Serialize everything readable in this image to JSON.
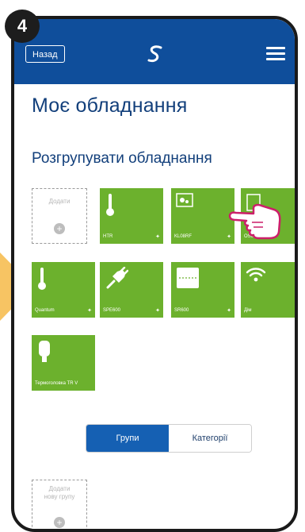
{
  "step": {
    "number": "4"
  },
  "header": {
    "back_label": "Назад"
  },
  "page_title": "Моє обладнання",
  "section_title": "Розгрупувати обладнання",
  "add_device": {
    "label": "Додати"
  },
  "devices": [
    {
      "label": "HTR",
      "icon": "thermometer-icon"
    },
    {
      "label": "KL08RF",
      "icon": "controller-box-icon"
    },
    {
      "label": "OS600",
      "icon": "window-sensor-icon"
    },
    {
      "label": "Quantum",
      "icon": "thermometer-icon"
    },
    {
      "label": "SPE600",
      "icon": "plug-icon"
    },
    {
      "label": "SR600",
      "icon": "relay-box-icon"
    },
    {
      "label": "Дім",
      "icon": "wifi-icon"
    },
    {
      "label": "Термоголовка TR V",
      "icon": "trv-head-icon"
    }
  ],
  "tabs": {
    "groups": "Групи",
    "categories": "Категорії"
  },
  "add_group": {
    "label": "Додати нову групу"
  },
  "colors": {
    "brand_blue": "#0f4e9b",
    "tile_green": "#6cb12d",
    "arrow_yellow": "#f7c463"
  }
}
